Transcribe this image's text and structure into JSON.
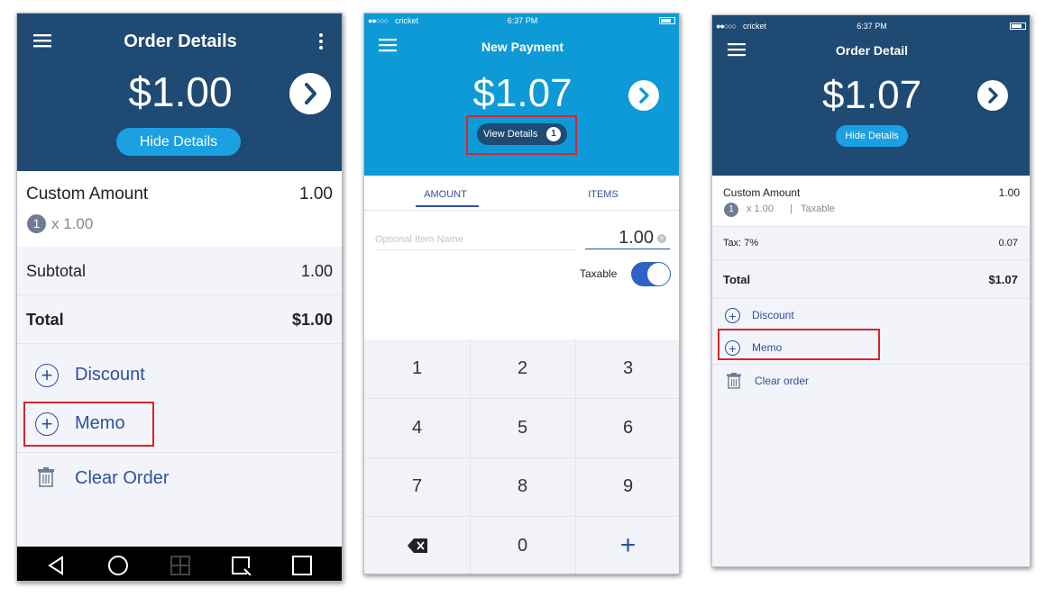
{
  "android": {
    "title": "Order Details",
    "amount": "$1.00",
    "hide_details": "Hide Details",
    "item_name": "Custom Amount",
    "item_value": "1.00",
    "qty": "1",
    "qty_price": "x 1.00",
    "subtotal_label": "Subtotal",
    "subtotal_value": "1.00",
    "total_label": "Total",
    "total_value": "$1.00",
    "discount": "Discount",
    "memo": "Memo",
    "clear_order": "Clear Order"
  },
  "ios_payment": {
    "carrier": "cricket",
    "time": "6:37 PM",
    "title": "New Payment",
    "amount": "$1.07",
    "view_details": "View Details",
    "badge": "1",
    "tab_amount": "AMOUNT",
    "tab_items": "ITEMS",
    "item_name_placeholder": "Optional Item Name",
    "amount_value": "1.00",
    "taxable": "Taxable",
    "keys": [
      "1",
      "2",
      "3",
      "4",
      "5",
      "6",
      "7",
      "8",
      "9",
      "",
      "0",
      "+"
    ]
  },
  "ios_detail": {
    "carrier": "cricket",
    "time": "6:37 PM",
    "title": "Order Detail",
    "amount": "$1.07",
    "hide_details": "Hide Details",
    "item_name": "Custom Amount",
    "item_value": "1.00",
    "qty": "1",
    "qty_price": "x 1.00",
    "taxable": "Taxable",
    "tax_label": "Tax: 7%",
    "tax_value": "0.07",
    "total_label": "Total",
    "total_value": "$1.07",
    "discount": "Discount",
    "memo": "Memo",
    "clear_order": "Clear order"
  },
  "colors": {
    "navy_header": "#1f4a73",
    "cyan_header": "#0d9ad6",
    "pill_blue": "#1ba0e2",
    "link_blue": "#2f4fa0",
    "highlight_red": "#d9242b",
    "toggle_blue": "#2f62c8"
  }
}
